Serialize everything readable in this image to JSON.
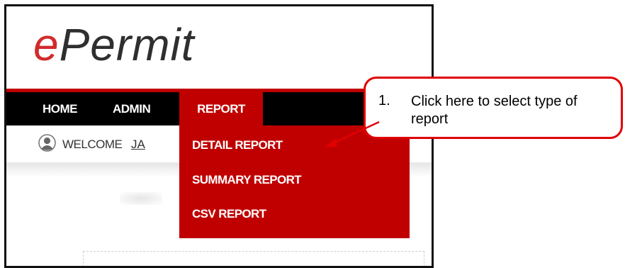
{
  "logo": {
    "e": "e",
    "rest": "Permit"
  },
  "nav": {
    "home": "HOME",
    "admin": "ADMIN",
    "report": "REPORT"
  },
  "welcome": {
    "label": "WELCOME",
    "name": "JA"
  },
  "report_menu": {
    "items": [
      {
        "label": "DETAIL REPORT"
      },
      {
        "label": "SUMMARY REPORT"
      },
      {
        "label": "CSV REPORT"
      }
    ]
  },
  "callout": {
    "number": "1.",
    "text": "Click here to select type of report"
  },
  "colors": {
    "brand_red": "#c00000",
    "nav_black": "#000000",
    "callout_red": "#e00000"
  },
  "icons": {
    "user": "user-avatar-icon",
    "arrow": "callout-arrow"
  }
}
